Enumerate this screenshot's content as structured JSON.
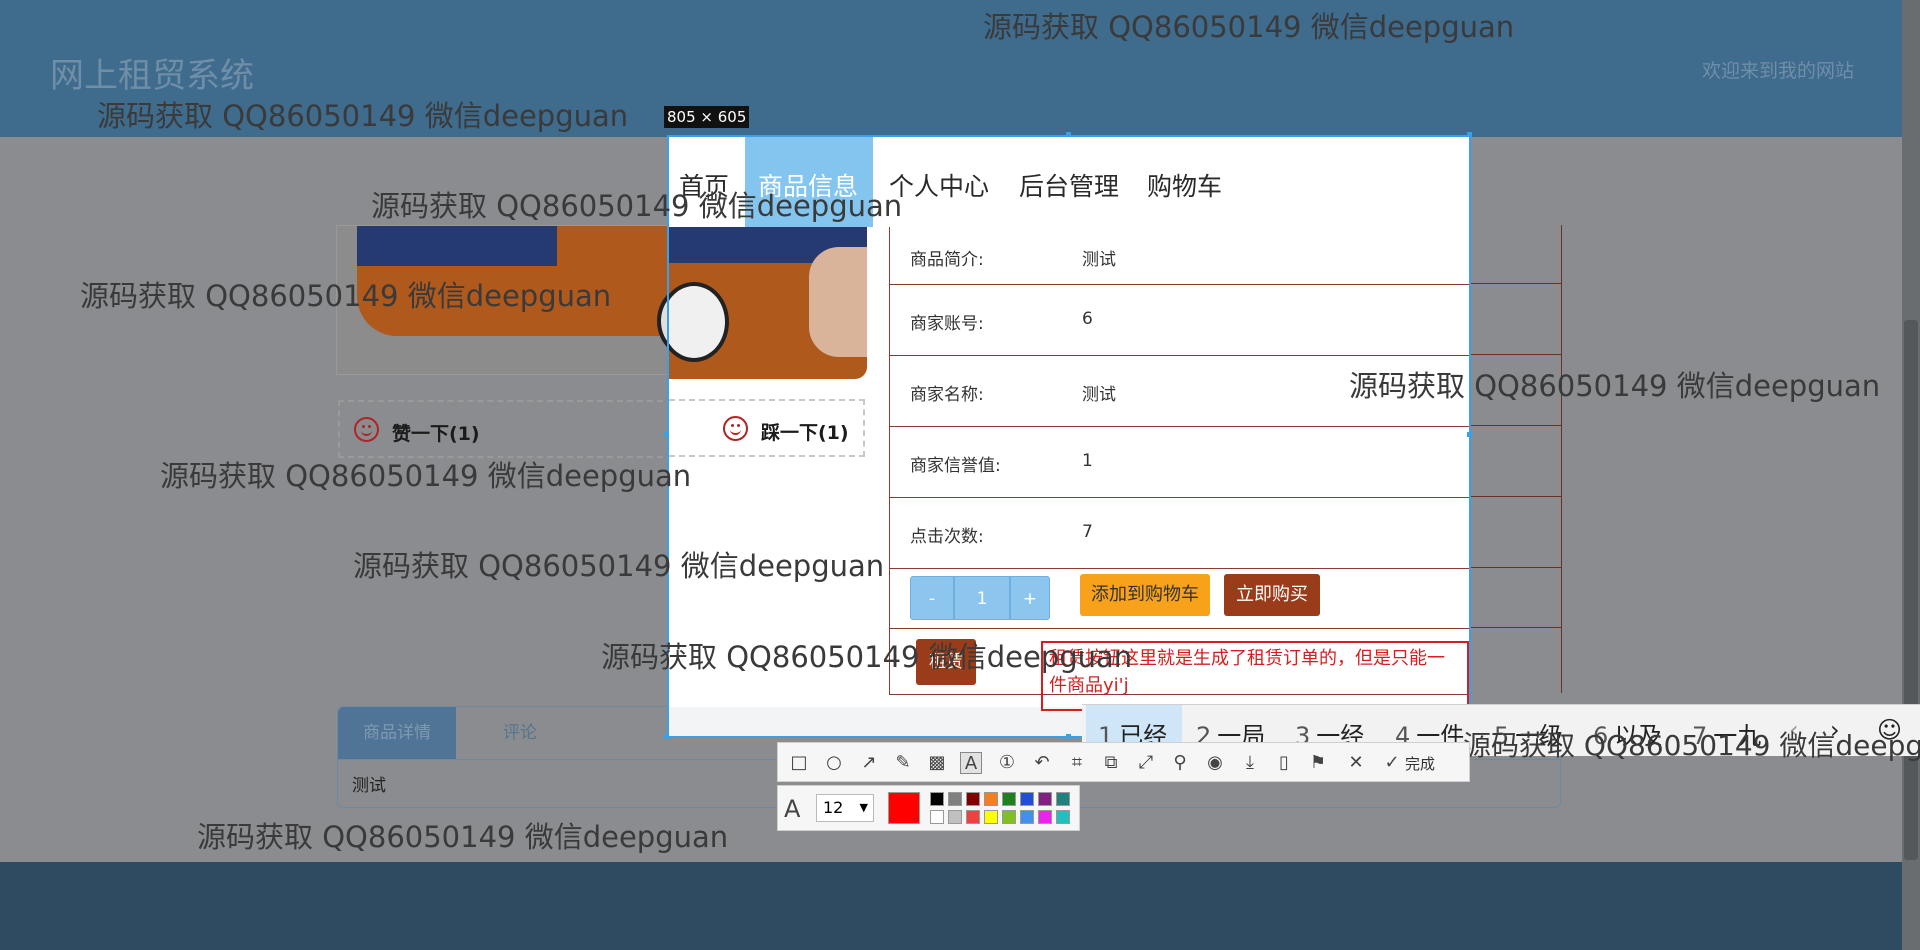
{
  "site": {
    "title": "网上租贸系统",
    "welcome": "欢迎来到我的网站"
  },
  "votes": {
    "like_label": "赞一下(1)",
    "dislike_label": "踩一下(1)"
  },
  "detail_tabs": {
    "tab_detail": "商品详情",
    "tab_comment": "评论",
    "body": "测试"
  },
  "watermark": "源码获取 QQ86050149 微信deepguan",
  "screenshot_tool": {
    "size_badge": "805 × 605",
    "annotation_text": "租赁按钮这里就是生成了租赁订单的，但是只能一件商品yi'j",
    "font_size": "12",
    "current_color": "#ff0000",
    "palette": [
      "#000000",
      "#808080",
      "#800000",
      "#f08020",
      "#208020",
      "#2050d0",
      "#802080",
      "#208080",
      "#ffffff",
      "#c0c0c0",
      "#f04040",
      "#ffff00",
      "#80c020",
      "#4090f0",
      "#f020f0",
      "#20c0c0"
    ],
    "done_label": "完成"
  },
  "nav": {
    "items": [
      "首页",
      "商品信息",
      "个人中心",
      "后台管理",
      "购物车"
    ],
    "active": "商品信息"
  },
  "product": {
    "rows": [
      {
        "label": "商品简介:",
        "value": "测试"
      },
      {
        "label": "商家账号:",
        "value": "6"
      },
      {
        "label": "商家名称:",
        "value": "测试"
      },
      {
        "label": "商家信誉值:",
        "value": "1"
      },
      {
        "label": "点击次数:",
        "value": "7"
      }
    ],
    "qty_minus": "-",
    "qty_value": "1",
    "qty_plus": "+",
    "add_to_cart": "添加到购物车",
    "buy_now": "立即购买",
    "rent": "租赁"
  },
  "ime": {
    "candidates": [
      {
        "num": "1",
        "text": "已经"
      },
      {
        "num": "2",
        "text": "一局"
      },
      {
        "num": "3",
        "text": "一经"
      },
      {
        "num": "4",
        "text": "一件"
      },
      {
        "num": "5",
        "text": "一级"
      },
      {
        "num": "6",
        "text": "以及"
      },
      {
        "num": "7",
        "text": "一九"
      }
    ]
  }
}
